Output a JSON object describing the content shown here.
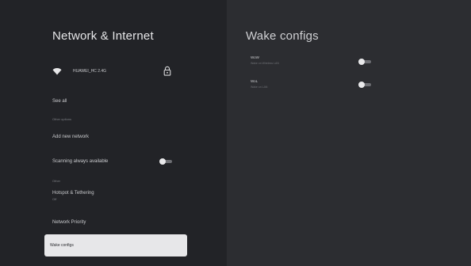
{
  "left": {
    "title": "Network & Internet",
    "wifi_network": "HUAWEI_HC 2.4G",
    "see_all": "See all",
    "other_options_caption": "Other options",
    "add_new_network": "Add new network",
    "scanning_label": "Scanning always available",
    "scanning_on": true,
    "other_caption": "Other",
    "hotspot_label": "Hotspot & Tethering",
    "hotspot_sub": "Off",
    "network_priority": "Network Priority",
    "wake_configs": "Wake configs"
  },
  "right": {
    "title": "Wake configs",
    "items": [
      {
        "title": "WoW",
        "sub": "Wake on Wireless LAN",
        "on": true
      },
      {
        "title": "WoL",
        "sub": "Wake on LAN",
        "on": true
      }
    ]
  }
}
